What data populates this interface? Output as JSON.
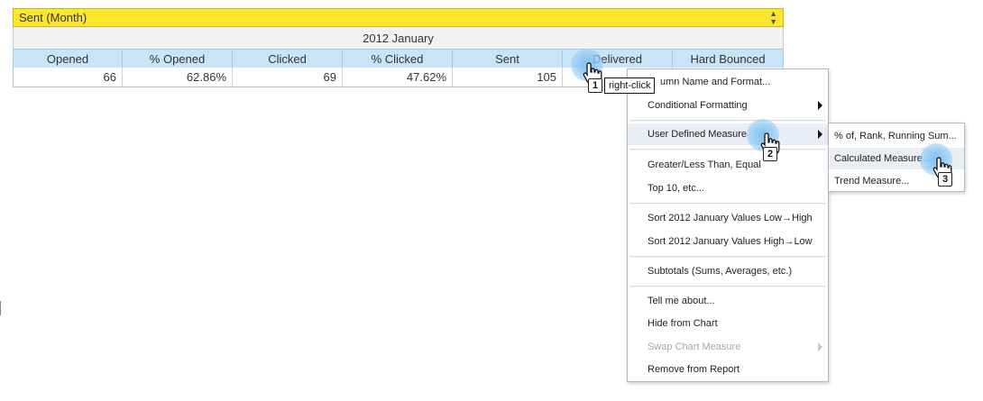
{
  "report": {
    "title": "Sent (Month)",
    "period": "2012 January",
    "columns": [
      "Opened",
      "% Opened",
      "Clicked",
      "% Clicked",
      "Sent",
      "Delivered",
      "Hard Bounced"
    ],
    "values": [
      "66",
      "62.86%",
      "69",
      "47.62%",
      "105",
      "",
      ""
    ]
  },
  "context_menu": {
    "items": [
      {
        "label": "Column Name and Format...",
        "visible_text": "umn Name and Format..."
      },
      {
        "label": "Conditional Formatting"
      },
      {
        "label": "User Defined Measure"
      },
      {
        "label": "Greater/Less Than, Equal To, etc...",
        "visible_text": "Greater/Less Than, Equal"
      },
      {
        "label": "Top 10, etc..."
      },
      {
        "label": "Sort 2012 January Values Low→High"
      },
      {
        "label": "Sort 2012 January Values High→Low"
      },
      {
        "label": "Subtotals (Sums, Averages, etc.)"
      },
      {
        "label": "Tell me about..."
      },
      {
        "label": "Hide from Chart"
      },
      {
        "label": "Swap Chart Measure"
      },
      {
        "label": "Remove from Report"
      }
    ]
  },
  "submenu": {
    "items": [
      {
        "label": "% of, Rank, Running Sum..."
      },
      {
        "label": "Calculated Measure..."
      },
      {
        "label": "Trend Measure..."
      }
    ]
  },
  "callouts": {
    "step1_label": "right-click",
    "step1": "1",
    "step2": "2",
    "step3": "3"
  },
  "colors": {
    "title_bar": "#ffe52e",
    "header_bg": "#c8e5f7",
    "callout_glow": "#78bef0"
  }
}
